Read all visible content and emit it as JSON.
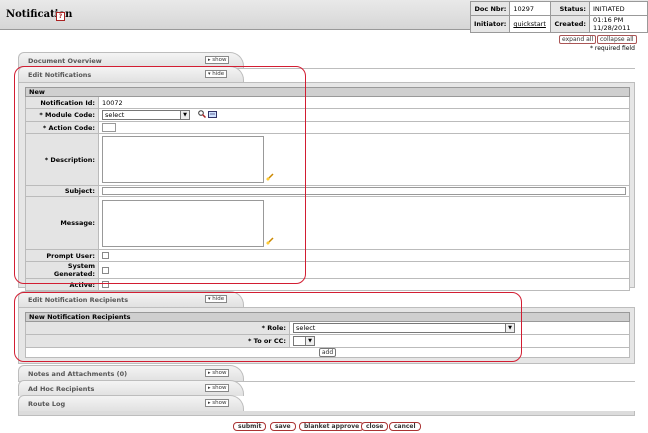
{
  "header": {
    "title": "Notification",
    "doc_nbr_label": "Doc Nbr:",
    "doc_nbr": "10297",
    "status_label": "Status:",
    "status": "INITIATED",
    "initiator_label": "Initiator:",
    "initiator": "quickstart",
    "created_label": "Created:",
    "created": "01:16 PM 11/28/2011"
  },
  "controls": {
    "expand_all": "expand all",
    "collapse_all": "collapse all",
    "required_note": "* required field"
  },
  "tabs": {
    "document_overview": "Document Overview",
    "edit_notifications": "Edit Notifications",
    "edit_recipients": "Edit Notification Recipients",
    "notes": "Notes and Attachments (0)",
    "adhoc": "Ad Hoc Recipients",
    "route_log": "Route Log",
    "show": "show",
    "hide": "hide"
  },
  "notification": {
    "section": "New",
    "id_label": "Notification Id:",
    "id_value": "10072",
    "module_label": "Module Code:",
    "module_value": "select",
    "action_label": "Action Code:",
    "description_label": "Description:",
    "subject_label": "Subject:",
    "message_label": "Message:",
    "prompt_label": "Prompt User:",
    "system_label": "System Generated:",
    "active_label": "Active:"
  },
  "recipients": {
    "section": "New Notification Recipients",
    "role_label": "Role:",
    "role_value": "select",
    "tocc_label": "To or CC:",
    "add_button": "add"
  },
  "buttons": {
    "submit": "submit",
    "save": "save",
    "blanket_approve": "blanket approve",
    "close": "close",
    "cancel": "cancel"
  },
  "colors": {
    "highlight": "#d21d32"
  }
}
